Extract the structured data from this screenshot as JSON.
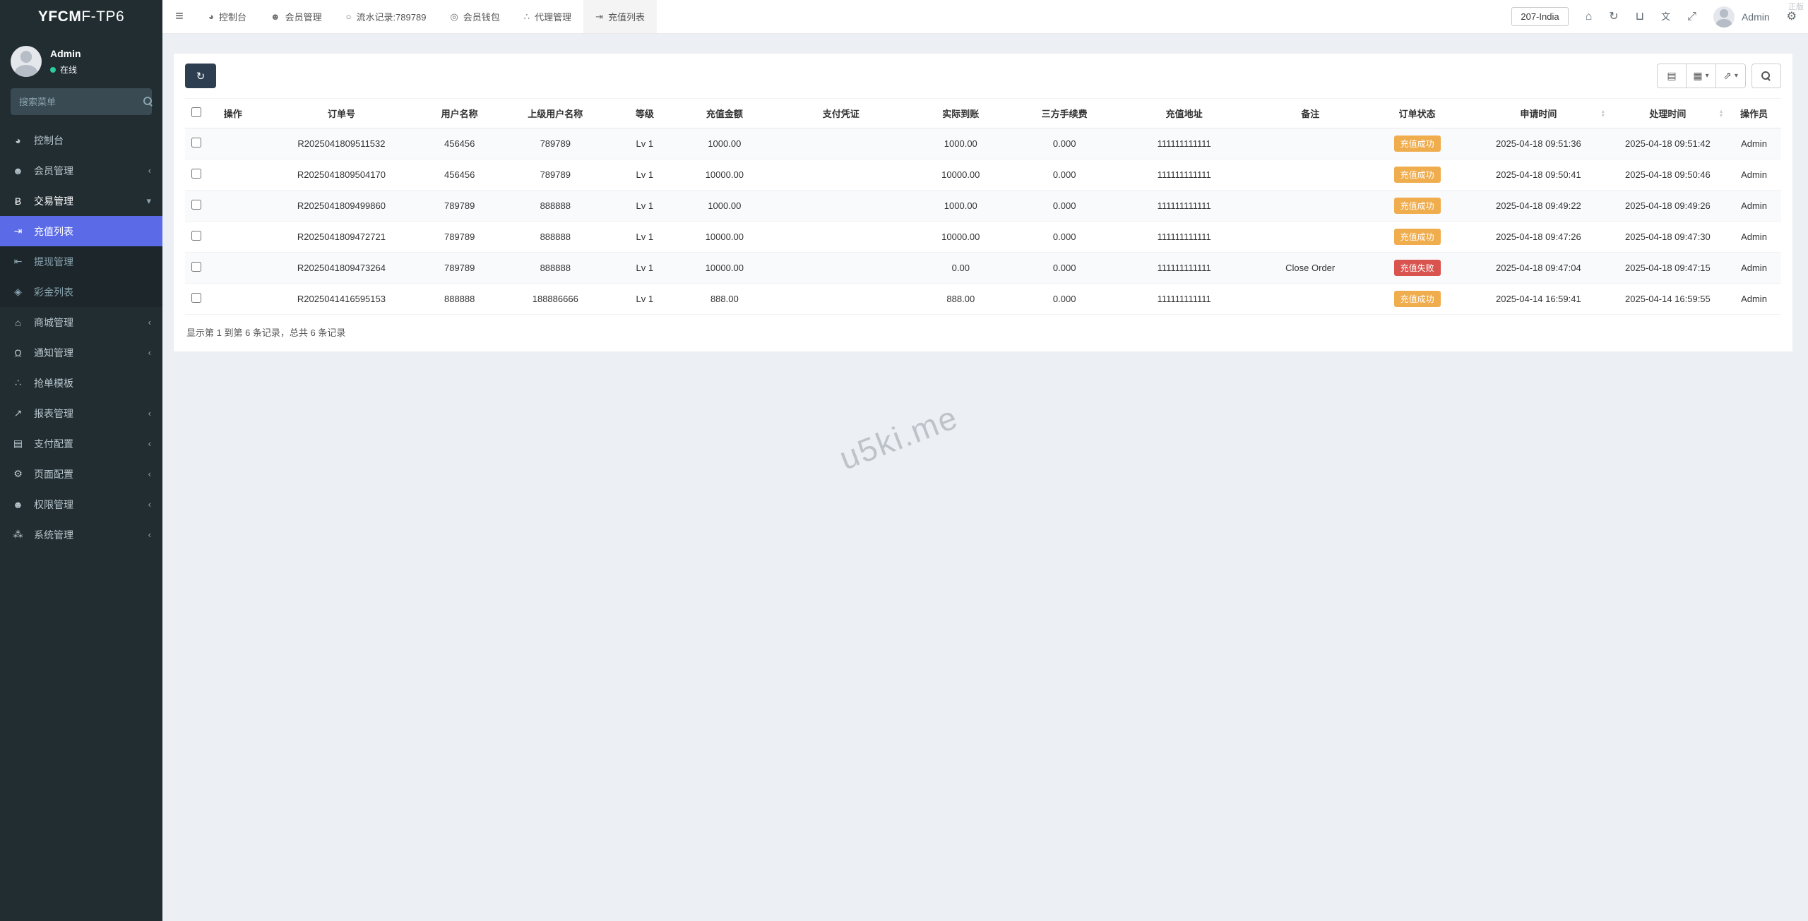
{
  "app": {
    "brand_bold": "YFCM",
    "brand_rest": "F-TP6",
    "license_tag": "正版"
  },
  "icons": {
    "hamburger": "≡",
    "caret_down": "▾",
    "sort_asc": "▴",
    "sort_desc": "▾",
    "toggle_view": "▤",
    "columns": "▦",
    "export": "⇗",
    "refresh": "↻",
    "home": "⌂",
    "trash": "⊔",
    "translate": "文",
    "fullscreen": "⤢",
    "cogs": "⚙"
  },
  "sidebar": {
    "user": {
      "name": "Admin",
      "status_label": "在线"
    },
    "search_placeholder": "搜索菜单",
    "menu": [
      {
        "id": "dashboard",
        "label": "控制台",
        "glyph": "◕",
        "icon": "dashboard-icon"
      },
      {
        "id": "members",
        "label": "会员管理",
        "glyph": "☻",
        "icon": "member-icon",
        "chevron": "‹"
      },
      {
        "id": "trade",
        "label": "交易管理",
        "glyph": "Ƀ",
        "icon": "bitcoin-icon",
        "chevron": "▾",
        "open": true,
        "children": [
          {
            "id": "recharge-list",
            "label": "充值列表",
            "glyph": "⇥",
            "icon": "sign-in-icon",
            "active": true
          },
          {
            "id": "withdraw",
            "label": "提现管理",
            "glyph": "⇤",
            "icon": "sign-out-icon"
          },
          {
            "id": "bonus-list",
            "label": "彩金列表",
            "glyph": "◈",
            "icon": "gift-icon"
          }
        ]
      },
      {
        "id": "mall",
        "label": "商城管理",
        "glyph": "⌂",
        "icon": "home-icon",
        "chevron": "‹"
      },
      {
        "id": "notice",
        "label": "通知管理",
        "glyph": "Ω",
        "icon": "bell-icon",
        "chevron": "‹"
      },
      {
        "id": "order-template",
        "label": "抢单模板",
        "glyph": "∴",
        "icon": "sitemap-icon"
      },
      {
        "id": "report",
        "label": "报表管理",
        "glyph": "↗",
        "icon": "chart-line-icon",
        "chevron": "‹"
      },
      {
        "id": "payment-config",
        "label": "支付配置",
        "glyph": "▤",
        "icon": "credit-card-icon",
        "chevron": "‹"
      },
      {
        "id": "page-config",
        "label": "页面配置",
        "glyph": "⚙",
        "icon": "gear-icon",
        "chevron": "‹"
      },
      {
        "id": "permission",
        "label": "权限管理",
        "glyph": "☻",
        "icon": "users-icon",
        "chevron": "‹"
      },
      {
        "id": "system",
        "label": "系统管理",
        "glyph": "⁂",
        "icon": "share-nodes-icon",
        "chevron": "‹"
      }
    ]
  },
  "topbar": {
    "tabs": [
      {
        "id": "dashboard",
        "label": "控制台",
        "glyph": "◕",
        "icon": "dashboard-icon"
      },
      {
        "id": "members",
        "label": "会员管理",
        "glyph": "☻",
        "icon": "member-icon"
      },
      {
        "id": "flow-record",
        "label": "流水记录:789789",
        "glyph": "○",
        "icon": "record-icon"
      },
      {
        "id": "member-wallet",
        "label": "会员钱包",
        "glyph": "◎",
        "icon": "wallet-icon"
      },
      {
        "id": "agent",
        "label": "代理管理",
        "glyph": "∴",
        "icon": "sitemap-icon"
      },
      {
        "id": "recharge-list",
        "label": "充值列表",
        "glyph": "⇥",
        "icon": "sign-in-icon",
        "active": true
      }
    ],
    "lang_select": "207-India",
    "user_name": "Admin"
  },
  "table": {
    "columns": [
      {
        "key": "checkbox",
        "label": "",
        "width": "1.4%"
      },
      {
        "key": "action",
        "label": "操作",
        "width": "3.2%"
      },
      {
        "key": "order_no",
        "label": "订单号",
        "width": "10.4%"
      },
      {
        "key": "username",
        "label": "用户名称",
        "width": "4.4%"
      },
      {
        "key": "parent",
        "label": "上级用户名称",
        "width": "7.6%"
      },
      {
        "key": "level",
        "label": "等级",
        "width": "3.6%"
      },
      {
        "key": "amount",
        "label": "充值金额",
        "width": "6.4%"
      },
      {
        "key": "voucher",
        "label": "支付凭证",
        "width": "8.2%"
      },
      {
        "key": "actual",
        "label": "实际到账",
        "width": "6.8%"
      },
      {
        "key": "fee",
        "label": "三方手续费",
        "width": "6.2%"
      },
      {
        "key": "address",
        "label": "充值地址",
        "width": "8.8%"
      },
      {
        "key": "remark",
        "label": "备注",
        "width": "7.0%"
      },
      {
        "key": "status",
        "label": "订单状态",
        "width": "6.4%"
      },
      {
        "key": "apply_time",
        "label": "申请时间",
        "width": "8.8%",
        "sortable": true
      },
      {
        "key": "process_time",
        "label": "处理时间",
        "width": "7.4%",
        "sortable": true
      },
      {
        "key": "operator",
        "label": "操作员",
        "width": "3.4%"
      }
    ],
    "rows": [
      {
        "order_no": "R2025041809511532",
        "username": "456456",
        "parent": "789789",
        "level": "Lv 1",
        "amount": "1000.00",
        "voucher": "",
        "actual": "1000.00",
        "fee": "0.000",
        "address": "111111111111",
        "remark": "",
        "status_text": "充值成功",
        "status_type": "success",
        "apply_time": "2025-04-18 09:51:36",
        "process_time": "2025-04-18 09:51:42",
        "operator": "Admin"
      },
      {
        "order_no": "R2025041809504170",
        "username": "456456",
        "parent": "789789",
        "level": "Lv 1",
        "amount": "10000.00",
        "voucher": "",
        "actual": "10000.00",
        "fee": "0.000",
        "address": "111111111111",
        "remark": "",
        "status_text": "充值成功",
        "status_type": "success",
        "apply_time": "2025-04-18 09:50:41",
        "process_time": "2025-04-18 09:50:46",
        "operator": "Admin"
      },
      {
        "order_no": "R2025041809499860",
        "username": "789789",
        "parent": "888888",
        "level": "Lv 1",
        "amount": "1000.00",
        "voucher": "",
        "actual": "1000.00",
        "fee": "0.000",
        "address": "111111111111",
        "remark": "",
        "status_text": "充值成功",
        "status_type": "success",
        "apply_time": "2025-04-18 09:49:22",
        "process_time": "2025-04-18 09:49:26",
        "operator": "Admin"
      },
      {
        "order_no": "R2025041809472721",
        "username": "789789",
        "parent": "888888",
        "level": "Lv 1",
        "amount": "10000.00",
        "voucher": "",
        "actual": "10000.00",
        "fee": "0.000",
        "address": "111111111111",
        "remark": "",
        "status_text": "充值成功",
        "status_type": "success",
        "apply_time": "2025-04-18 09:47:26",
        "process_time": "2025-04-18 09:47:30",
        "operator": "Admin"
      },
      {
        "order_no": "R2025041809473264",
        "username": "789789",
        "parent": "888888",
        "level": "Lv 1",
        "amount": "10000.00",
        "voucher": "",
        "actual": "0.00",
        "fee": "0.000",
        "address": "111111111111",
        "remark": "Close Order",
        "status_text": "充值失败",
        "status_type": "danger",
        "apply_time": "2025-04-18 09:47:04",
        "process_time": "2025-04-18 09:47:15",
        "operator": "Admin"
      },
      {
        "order_no": "R2025041416595153",
        "username": "888888",
        "parent": "188886666",
        "level": "Lv 1",
        "amount": "888.00",
        "voucher": "",
        "actual": "888.00",
        "fee": "0.000",
        "address": "111111111111",
        "remark": "",
        "status_text": "充值成功",
        "status_type": "success",
        "apply_time": "2025-04-14 16:59:41",
        "process_time": "2025-04-14 16:59:55",
        "operator": "Admin"
      }
    ],
    "summary": "显示第 1 到第 6 条记录，总共 6 条记录"
  },
  "watermark": "u5ki.me",
  "colors": {
    "sidebar_bg": "#222d32",
    "submenu_bg": "#1c262b",
    "active_item": "#5b6be8",
    "badge_success": "#f0ad4e",
    "badge_danger": "#d9534f",
    "refresh_button": "#2c3e50",
    "online_dot": "#2ecc9a",
    "content_bg": "#ecf0f5"
  }
}
